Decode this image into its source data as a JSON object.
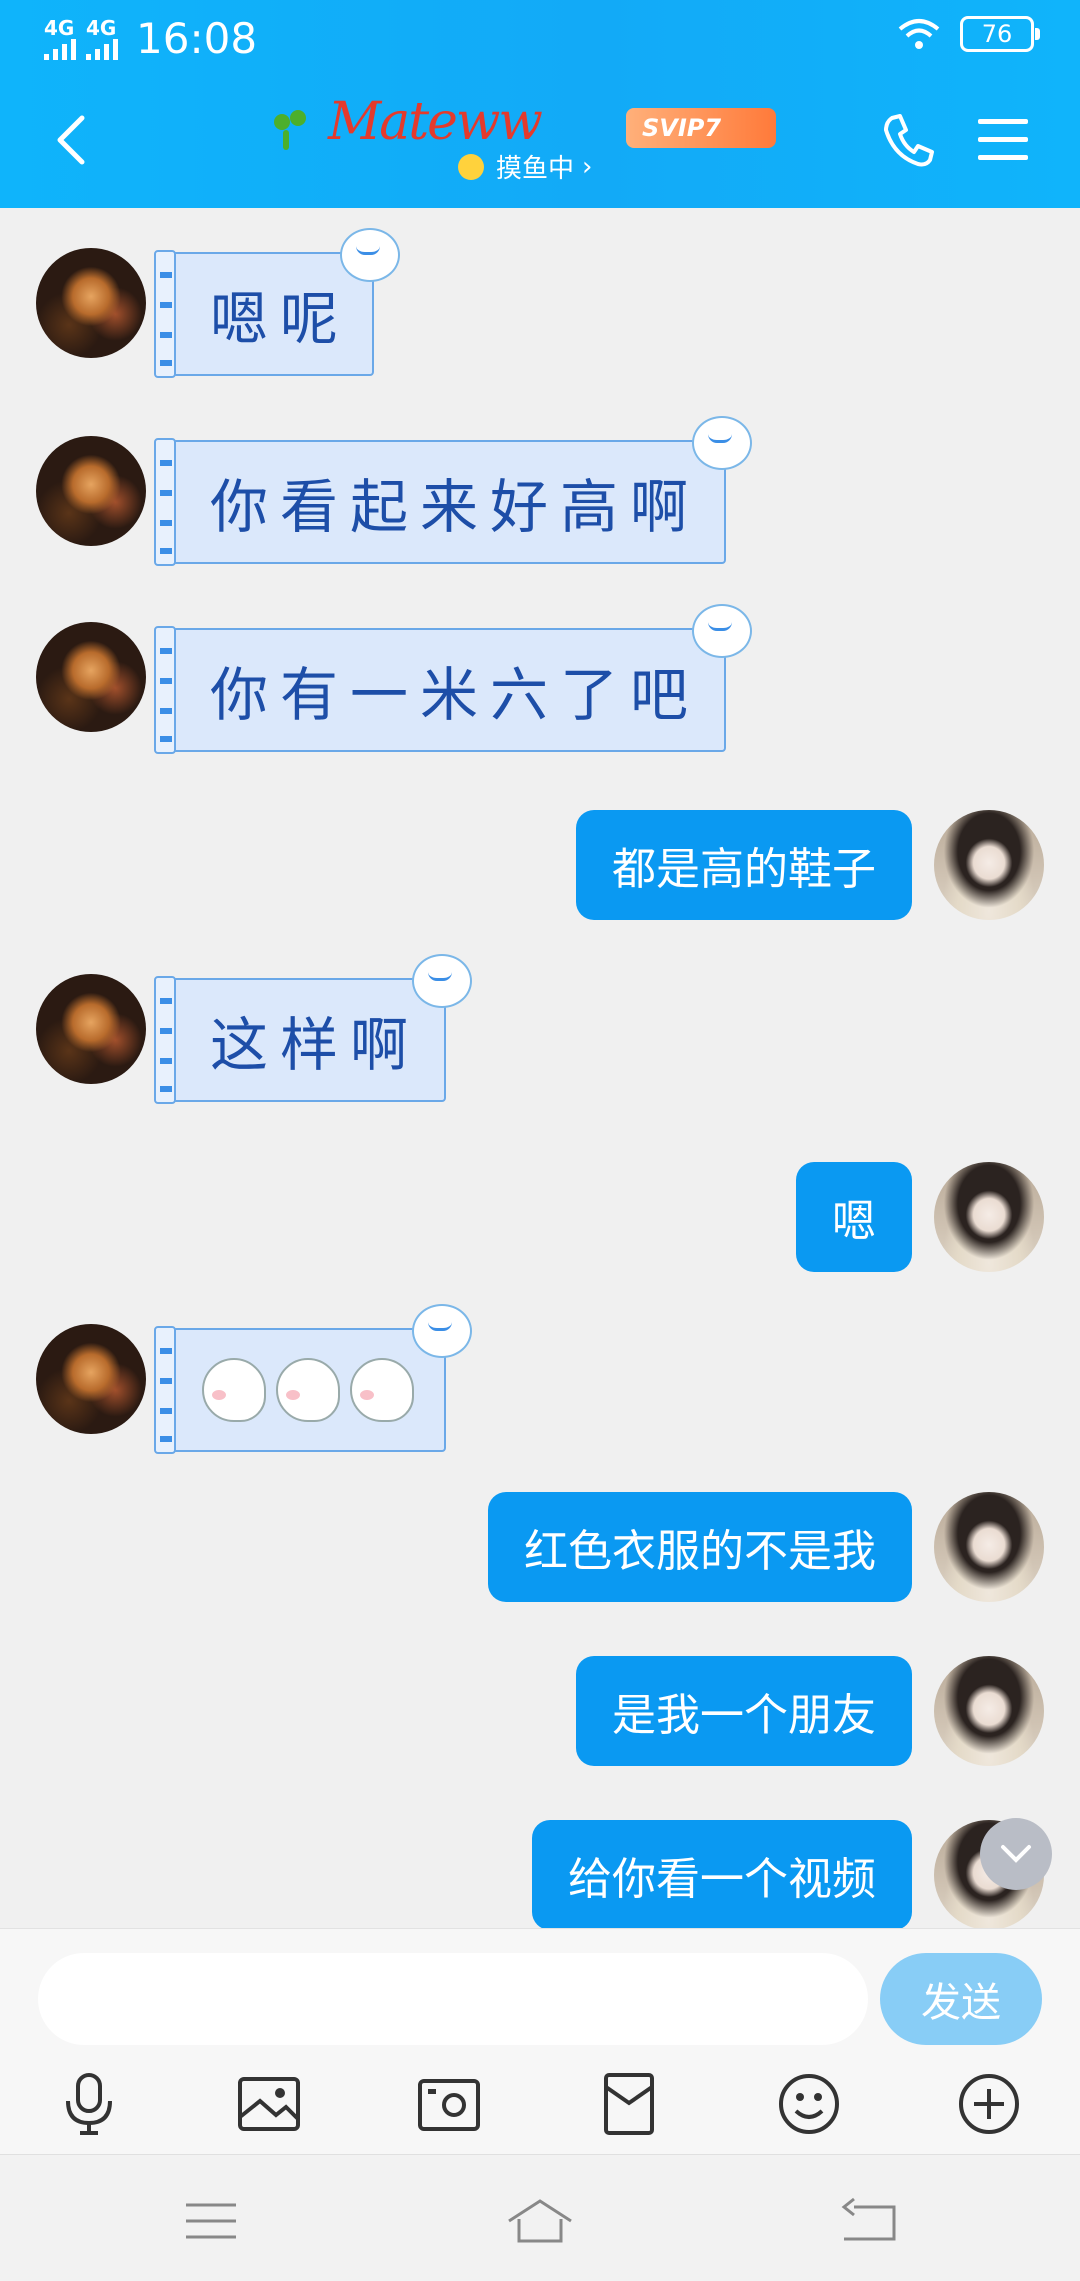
{
  "status_bar": {
    "time": "16:08",
    "network_1": "4G",
    "network_2": "4G",
    "battery": "76"
  },
  "header": {
    "contact_name": "Mateww",
    "vip_badge": "SVIP7",
    "status": "摸鱼中",
    "status_chevron": "›",
    "icons": [
      "back-icon",
      "phone-icon",
      "menu-icon"
    ]
  },
  "messages": [
    {
      "sender": "other",
      "text": "嗯呢"
    },
    {
      "sender": "other",
      "text": "你看起来好高啊"
    },
    {
      "sender": "other",
      "text": "你有一米六了吧"
    },
    {
      "sender": "me",
      "text": "都是高的鞋子"
    },
    {
      "sender": "other",
      "text": "这样啊"
    },
    {
      "sender": "me",
      "text": "嗯"
    },
    {
      "sender": "other",
      "text": "",
      "stickers": 3
    },
    {
      "sender": "me",
      "text": "红色衣服的不是我"
    },
    {
      "sender": "me",
      "text": "是我一个朋友"
    },
    {
      "sender": "me",
      "text": "给你看一个视频"
    }
  ],
  "input": {
    "placeholder": "",
    "send_label": "发送"
  },
  "toolbar": [
    "microphone-icon",
    "image-icon",
    "camera-icon",
    "red-packet-icon",
    "emoji-icon",
    "plus-icon"
  ],
  "colors": {
    "header": "#12aaf7",
    "my_bubble": "#0a99f2",
    "other_bubble": "#dbe8fb",
    "other_text": "#1d4ea8",
    "send_button": "#88cdf6"
  }
}
